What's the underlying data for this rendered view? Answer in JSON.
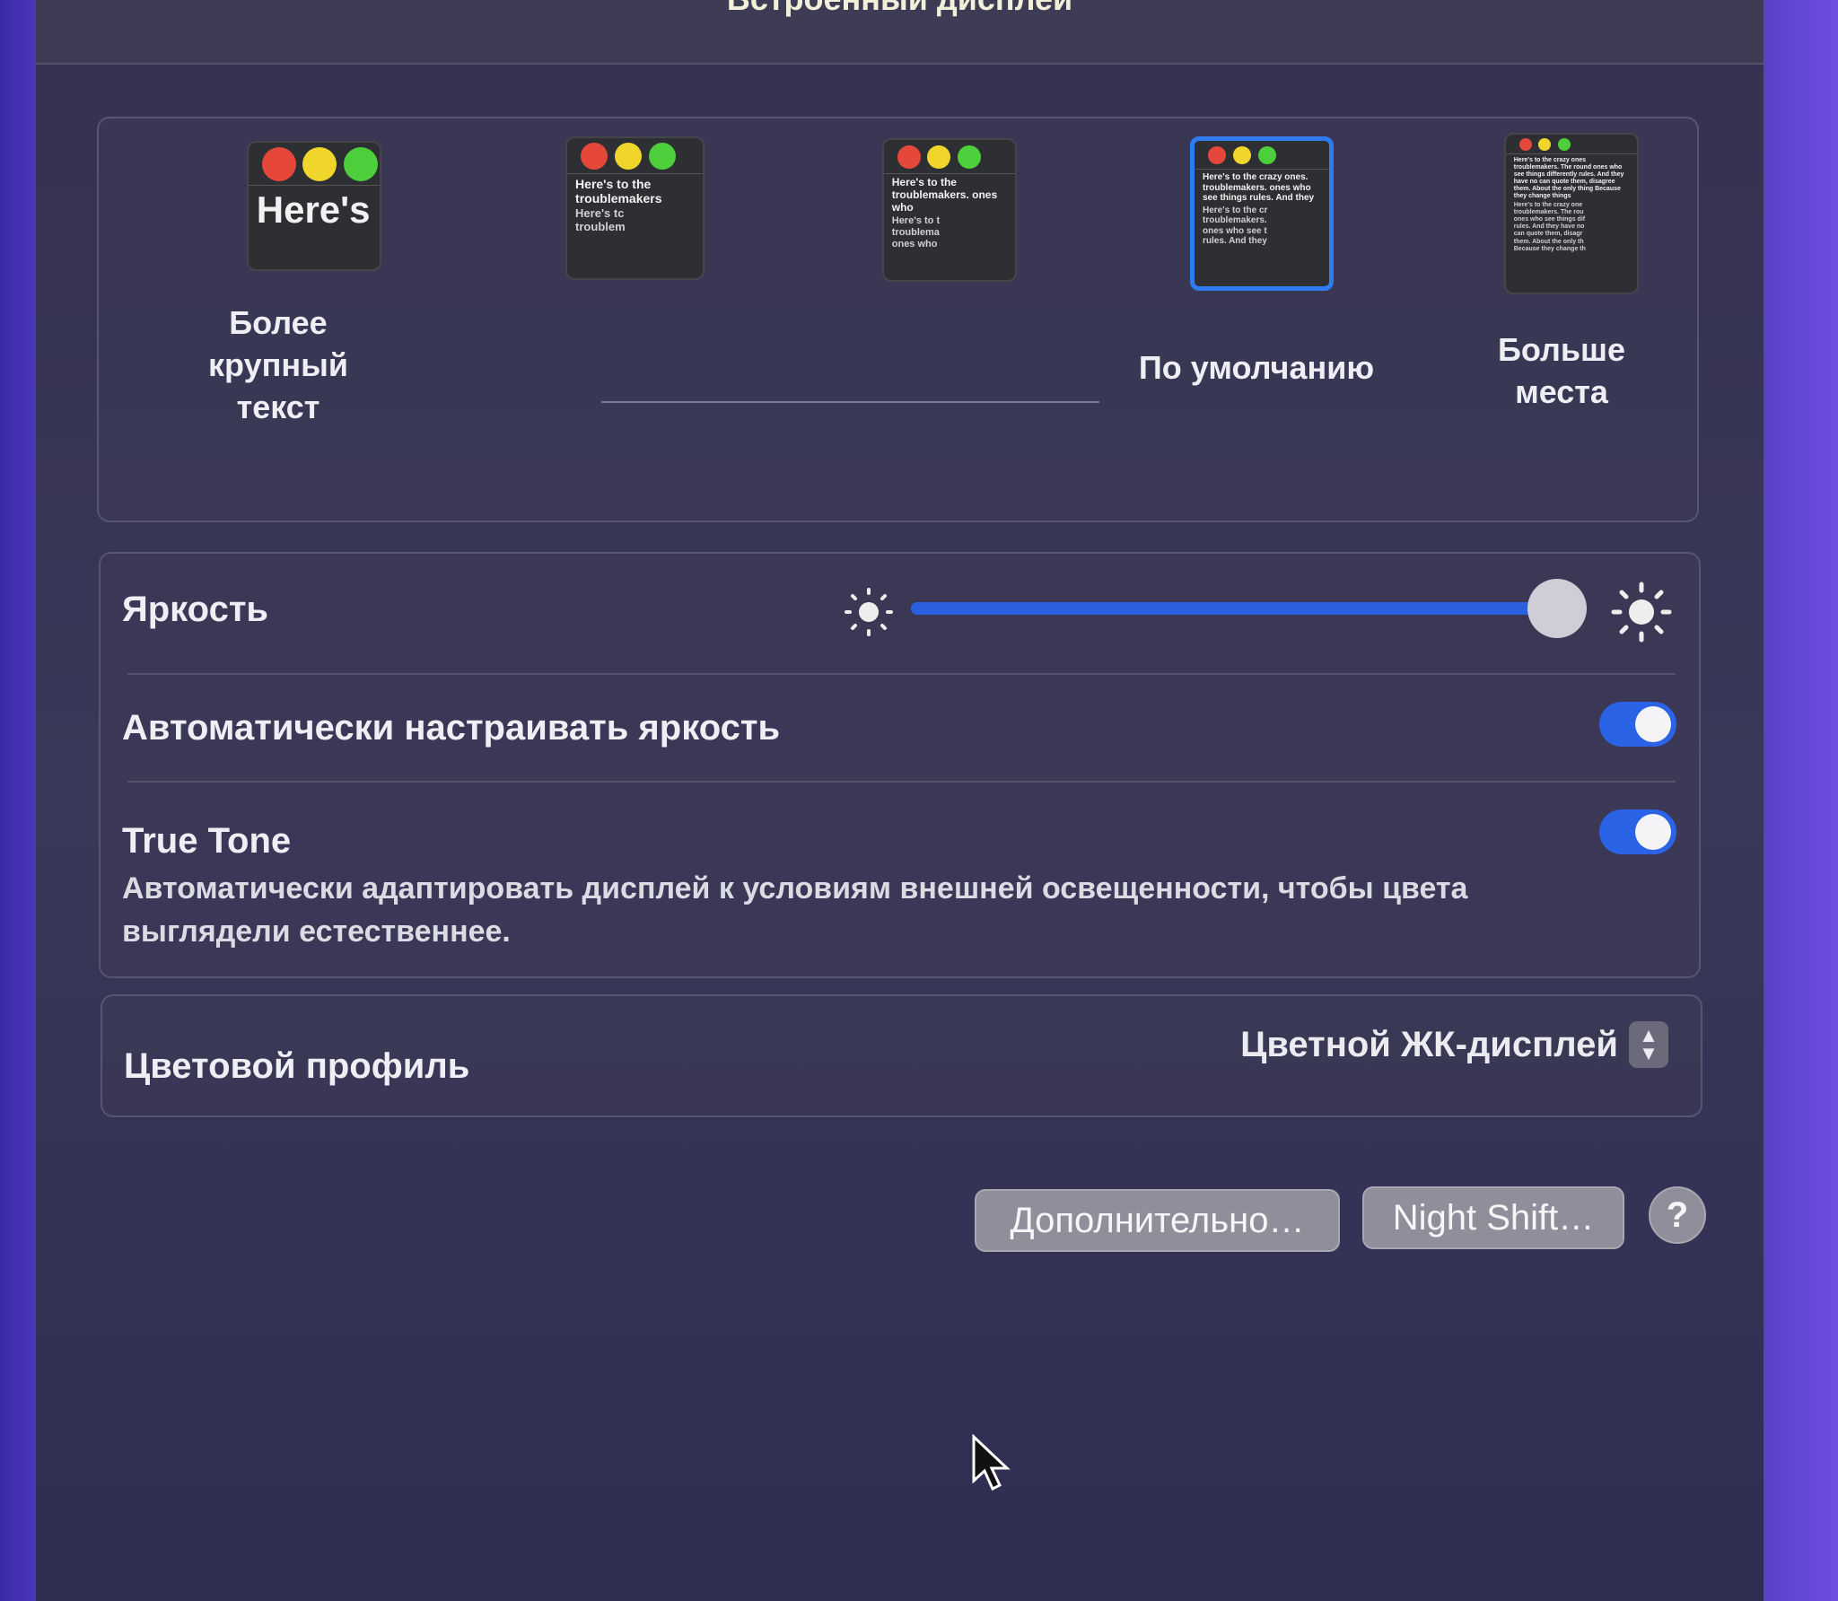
{
  "window": {
    "title": "Встроенный дисплей"
  },
  "resolution": {
    "options": [
      {
        "label": "Более крупный текст",
        "preview": "Here's",
        "selected": false
      },
      {
        "label": "",
        "preview": "Here's to the troublemakers",
        "selected": false
      },
      {
        "label": "",
        "preview": "Here's to the troublemakers. ones who",
        "selected": false
      },
      {
        "label": "По умолчанию",
        "preview": "Here's to the crazy ones. troublemakers. ones who see things rules. And they",
        "selected": true
      },
      {
        "label": "Больше места",
        "preview": "Here's to the crazy ones troublemakers. The round ones who see things differently rules. And they have no can quote them, disagree them. About the only thing Because they change things",
        "selected": false
      }
    ],
    "preview_lines": [
      [
        "Here's"
      ],
      [
        "Here's tc",
        "troublem"
      ],
      [
        "Here's to t",
        "troublema",
        "ones who"
      ],
      [
        "Here's to the cr",
        "troublemakers.",
        "ones who see t",
        "rules. And they"
      ],
      [
        "Here's to the crazy one",
        "troublemakers. The rou",
        "ones who see things dif",
        "rules. And they have no",
        "can quote them, disagr",
        "them. About the only th",
        "Because they change th"
      ]
    ]
  },
  "brightness": {
    "label": "Яркость",
    "value_percent": 100,
    "icon_low": "sun-small-icon",
    "icon_high": "sun-large-icon"
  },
  "auto_brightness": {
    "label": "Автоматически настраивать яркость",
    "enabled": true
  },
  "true_tone": {
    "label": "True Tone",
    "description": "Автоматически адаптировать дисплей к условиям внешней освещенности, чтобы цвета выглядели естественнее.",
    "enabled": true
  },
  "color_profile": {
    "label": "Цветовой профиль",
    "value": "Цветной ЖК-дисплей"
  },
  "buttons": {
    "advanced": "Дополнительно…",
    "night_shift": "Night Shift…",
    "help": "?"
  },
  "colors": {
    "accent": "#2a63e6",
    "selected_border": "#2f7bf0",
    "red": "#e5483a",
    "yellow": "#f0d62a",
    "green": "#4ccf3a"
  }
}
